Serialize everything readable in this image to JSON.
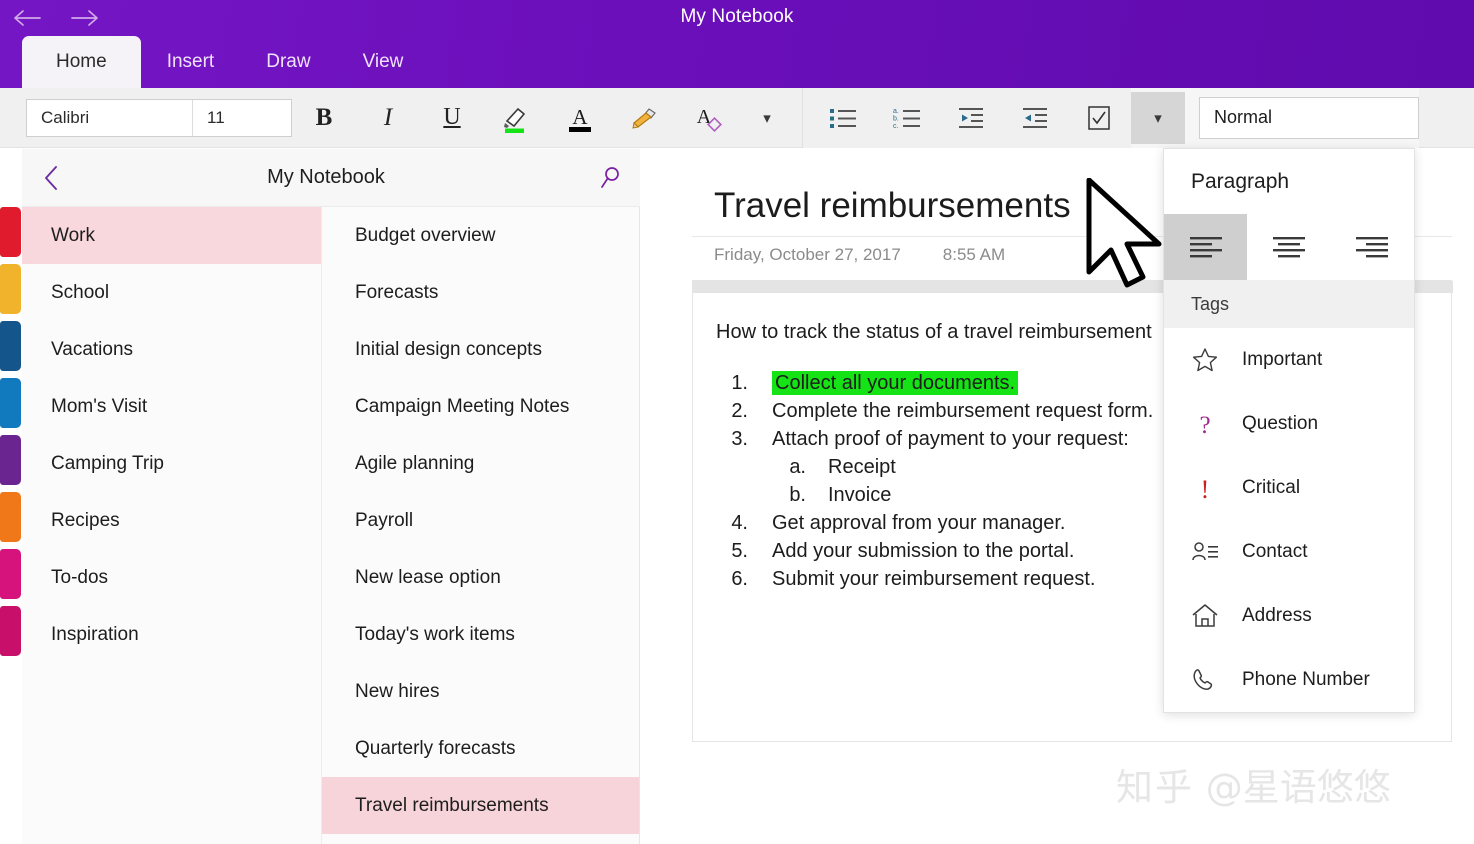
{
  "window": {
    "title": "My Notebook",
    "back_arrow": "back-arrow",
    "forward_arrow": "forward-arrow"
  },
  "ribbon_tabs": [
    {
      "label": "Home",
      "active": true
    },
    {
      "label": "Insert",
      "active": false
    },
    {
      "label": "Draw",
      "active": false
    },
    {
      "label": "View",
      "active": false
    }
  ],
  "ribbon": {
    "font_name": "Calibri",
    "font_size": "11",
    "bold_label": "B",
    "italic_label": "I",
    "underline_label": "U",
    "highlight_icon": "highlighter-icon",
    "highlight_color": "#16e316",
    "font_color_icon": "font-color-icon",
    "font_color": "#000000",
    "format_painter_icon": "format-painter-icon",
    "clear_formatting_icon": "clear-formatting-icon",
    "more_font_chevron": "chevron-down-icon",
    "bullets_icon": "bulleted-list-icon",
    "numbering_icon": "numbered-list-icon",
    "decrease_indent_icon": "decrease-indent-icon",
    "increase_indent_icon": "increase-indent-icon",
    "todo_icon": "checkbox-todo-icon",
    "paragraph_expand_chevron": "chevron-down-icon",
    "style_value": "Normal"
  },
  "notebook_pane": {
    "back_icon": "chevron-left-icon",
    "title": "My Notebook",
    "search_icon": "search-icon"
  },
  "sections": [
    {
      "label": "Work",
      "color": "#e01b2e",
      "selected": true
    },
    {
      "label": "School",
      "color": "#f0b32b",
      "selected": false
    },
    {
      "label": "Vacations",
      "color": "#14568c",
      "selected": false
    },
    {
      "label": "Mom's Visit",
      "color": "#1179bd",
      "selected": false
    },
    {
      "label": "Camping Trip",
      "color": "#6b2590",
      "selected": false
    },
    {
      "label": "Recipes",
      "color": "#f07818",
      "selected": false
    },
    {
      "label": "To-dos",
      "color": "#d6127c",
      "selected": false
    },
    {
      "label": "Inspiration",
      "color": "#c8106a",
      "selected": false
    }
  ],
  "pages": [
    {
      "label": "Budget overview",
      "selected": false
    },
    {
      "label": "Forecasts",
      "selected": false
    },
    {
      "label": "Initial design concepts",
      "selected": false
    },
    {
      "label": "Campaign Meeting Notes",
      "selected": false
    },
    {
      "label": "Agile planning",
      "selected": false
    },
    {
      "label": "Payroll",
      "selected": false
    },
    {
      "label": "New lease option",
      "selected": false
    },
    {
      "label": "Today's work items",
      "selected": false
    },
    {
      "label": "New hires",
      "selected": false
    },
    {
      "label": "Quarterly forecasts",
      "selected": false
    },
    {
      "label": "Travel reimbursements",
      "selected": true
    }
  ],
  "note": {
    "title": "Travel reimbursements",
    "date": "Friday, October 27, 2017",
    "time": "8:55 AM",
    "intro": "How to track the status of a travel reimbursement",
    "items": [
      {
        "marker": "1.",
        "text": "Collect all your documents.",
        "sub": false,
        "highlighted": true
      },
      {
        "marker": "2.",
        "text": "Complete the reimbursement request form.",
        "sub": false,
        "highlighted": false
      },
      {
        "marker": "3.",
        "text": "Attach proof of payment to your request:",
        "sub": false,
        "highlighted": false
      },
      {
        "marker": "a.",
        "text": "Receipt",
        "sub": true,
        "highlighted": false
      },
      {
        "marker": "b.",
        "text": "Invoice",
        "sub": true,
        "highlighted": false
      },
      {
        "marker": "4.",
        "text": "Get approval from your manager.",
        "sub": false,
        "highlighted": false
      },
      {
        "marker": "5.",
        "text": "Add your submission to the portal.",
        "sub": false,
        "highlighted": false
      },
      {
        "marker": "6.",
        "text": "Submit your reimbursement request.",
        "sub": false,
        "highlighted": false
      }
    ]
  },
  "dropdown": {
    "paragraph_header": "Paragraph",
    "align_buttons": [
      {
        "name": "align-left-button",
        "active": true
      },
      {
        "name": "align-center-button",
        "active": false
      },
      {
        "name": "align-right-button",
        "active": false
      }
    ],
    "tags_header": "Tags",
    "tags": [
      {
        "label": "Important",
        "icon": "star-icon",
        "color": "#3b3b3b"
      },
      {
        "label": "Question",
        "icon": "question-mark-icon",
        "color": "#a0298f"
      },
      {
        "label": "Critical",
        "icon": "exclamation-icon",
        "color": "#cc1f1f"
      },
      {
        "label": "Contact",
        "icon": "contact-icon",
        "color": "#3b3b3b"
      },
      {
        "label": "Address",
        "icon": "home-icon",
        "color": "#3b3b3b"
      },
      {
        "label": "Phone Number",
        "icon": "phone-icon",
        "color": "#3b3b3b"
      }
    ]
  },
  "watermark": {
    "logo": "知乎",
    "handle": "@星语悠悠"
  },
  "colors": {
    "titlebar": "#6b0fbb",
    "selection_pink": "#f7d4da",
    "ribbon_bg": "#f0f0f0",
    "highlight_green": "#16e316"
  }
}
